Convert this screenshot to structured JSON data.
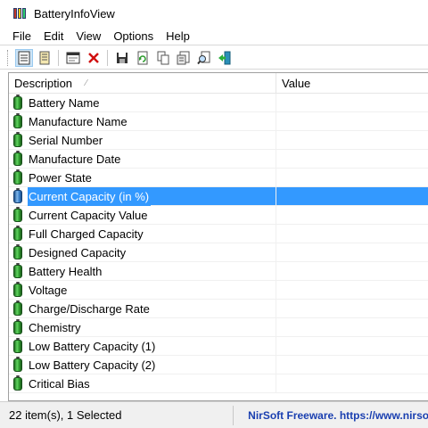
{
  "window": {
    "title": "BatteryInfoView"
  },
  "menu": [
    "File",
    "Edit",
    "View",
    "Options",
    "Help"
  ],
  "list": {
    "columns": {
      "description": "Description",
      "value": "Value"
    },
    "rows": [
      {
        "label": "Battery Name",
        "selected": false
      },
      {
        "label": "Manufacture Name",
        "selected": false
      },
      {
        "label": "Serial Number",
        "selected": false
      },
      {
        "label": "Manufacture Date",
        "selected": false
      },
      {
        "label": "Power State",
        "selected": false
      },
      {
        "label": "Current Capacity (in %)",
        "selected": true
      },
      {
        "label": "Current Capacity Value",
        "selected": false
      },
      {
        "label": "Full Charged Capacity",
        "selected": false
      },
      {
        "label": "Designed Capacity",
        "selected": false
      },
      {
        "label": "Battery Health",
        "selected": false
      },
      {
        "label": "Voltage",
        "selected": false
      },
      {
        "label": "Charge/Discharge Rate",
        "selected": false
      },
      {
        "label": "Chemistry",
        "selected": false
      },
      {
        "label": "Low Battery Capacity (1)",
        "selected": false
      },
      {
        "label": "Low Battery Capacity (2)",
        "selected": false
      },
      {
        "label": "Critical Bias",
        "selected": false
      }
    ]
  },
  "status": {
    "count": "22 item(s), 1 Selected",
    "credit": "NirSoft Freeware. https://www.nirsoft.net"
  },
  "colors": {
    "selection": "#3399ff",
    "credit": "#1a3fb0",
    "battery_green": "#2e9b2e"
  }
}
